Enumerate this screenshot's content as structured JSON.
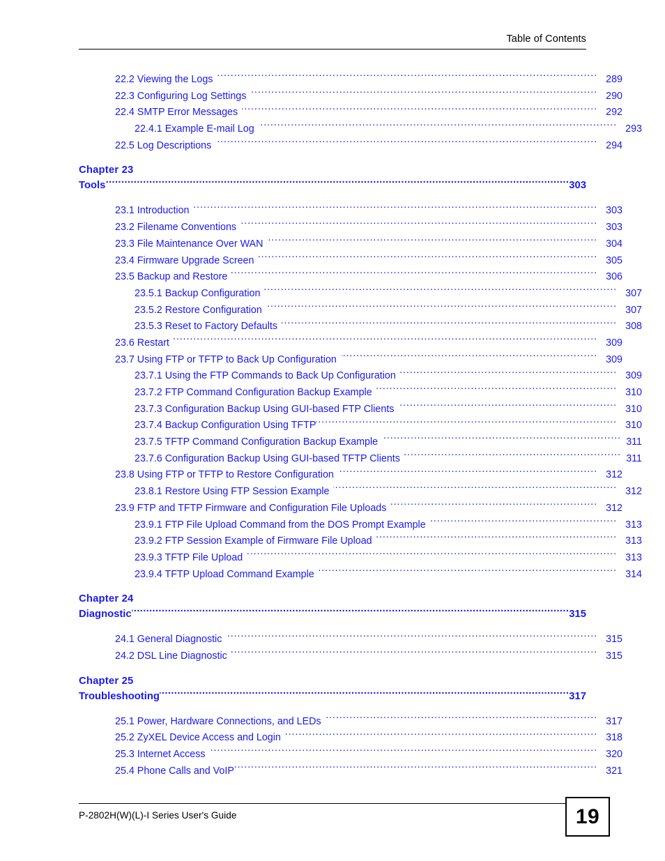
{
  "header": {
    "title": "Table of Contents"
  },
  "footer": {
    "guide_title": "P-2802H(W)(L)-I Series User's Guide",
    "page_number": "19"
  },
  "toc": {
    "blocks": [
      {
        "type": "entries",
        "entries": [
          {
            "level": 1,
            "label": "22.2 Viewing the Logs",
            "page": "289",
            "gap_before_leader": "wide",
            "gap_after_leader": "wide"
          },
          {
            "level": 1,
            "label": "22.3 Configuring Log Settings",
            "page": "290",
            "gap_before_leader": "wide",
            "gap_after_leader": "wide"
          },
          {
            "level": 1,
            "label": "22.4 SMTP Error Messages",
            "page": "292",
            "gap_before_leader": "wide",
            "gap_after_leader": "wide"
          },
          {
            "level": 2,
            "label": "22.4.1 Example E-mail Log",
            "page": "293",
            "gap_before_leader": "wide",
            "gap_after_leader": "wide"
          },
          {
            "level": 1,
            "label": "22.5 Log Descriptions",
            "page": "294",
            "gap_before_leader": "wide",
            "gap_after_leader": "wide"
          }
        ]
      },
      {
        "type": "chapter",
        "chapter_label": "Chapter  23",
        "chapter_title": "Tools",
        "page": "303"
      },
      {
        "type": "entries",
        "entries": [
          {
            "level": 1,
            "label": "23.1 Introduction",
            "page": "303",
            "gap_before_leader": "wide",
            "gap_after_leader": "wide"
          },
          {
            "level": 1,
            "label": "23.2 Filename Conventions",
            "page": "303",
            "gap_before_leader": "wide",
            "gap_after_leader": "wide"
          },
          {
            "level": 1,
            "label": "23.3 File Maintenance Over WAN",
            "page": "304",
            "gap_before_leader": "wide",
            "gap_after_leader": "wide"
          },
          {
            "level": 1,
            "label": "23.4 Firmware Upgrade Screen",
            "page": "305",
            "gap_before_leader": "wide",
            "gap_after_leader": "wide"
          },
          {
            "level": 1,
            "label": "23.5 Backup and Restore",
            "page": "306",
            "gap_before_leader": "wide",
            "gap_after_leader": "wide"
          },
          {
            "level": 2,
            "label": "23.5.1 Backup Configuration",
            "page": "307",
            "gap_before_leader": "wide",
            "gap_after_leader": "wide"
          },
          {
            "level": 2,
            "label": "23.5.2 Restore Configuration",
            "page": "307",
            "gap_before_leader": "wide",
            "gap_after_leader": "wide"
          },
          {
            "level": 2,
            "label": "23.5.3 Reset to Factory Defaults",
            "page": "308",
            "gap_before_leader": "wide",
            "gap_after_leader": "wide"
          },
          {
            "level": 1,
            "label": "23.6 Restart",
            "page": "309",
            "gap_before_leader": "wide",
            "gap_after_leader": "wide"
          },
          {
            "level": 1,
            "label": "23.7 Using FTP or TFTP to Back Up Configuration",
            "page": "309",
            "gap_before_leader": "wide",
            "gap_after_leader": "wide"
          },
          {
            "level": 2,
            "label": "23.7.1 Using the FTP Commands to Back Up Configuration",
            "page": "309",
            "gap_before_leader": "wide",
            "gap_after_leader": "wide"
          },
          {
            "level": 2,
            "label": "23.7.2 FTP Command  Configuration Backup Example",
            "page": "310",
            "gap_before_leader": "wide",
            "gap_after_leader": "wide"
          },
          {
            "level": 2,
            "label": "23.7.3 Configuration Backup Using GUI-based FTP Clients",
            "page": "310",
            "gap_before_leader": "wide",
            "gap_after_leader": "wide"
          },
          {
            "level": 2,
            "label": "23.7.4 Backup Configuration Using TFTP",
            "page": "310",
            "gap_before_leader": "none",
            "gap_after_leader": "wide"
          },
          {
            "level": 2,
            "label": "23.7.5 TFTP Command Configuration Backup Example",
            "page": "311",
            "gap_before_leader": "wide",
            "gap_after_leader": "none"
          },
          {
            "level": 2,
            "label": "23.7.6 Configuration Backup Using GUI-based TFTP Clients",
            "page": "311",
            "gap_before_leader": "wide",
            "gap_after_leader": "none"
          },
          {
            "level": 1,
            "label": "23.8 Using FTP or TFTP to Restore Configuration",
            "page": "312",
            "gap_before_leader": "wide",
            "gap_after_leader": "wide"
          },
          {
            "level": 2,
            "label": "23.8.1 Restore Using FTP Session Example",
            "page": "312",
            "gap_before_leader": "wide",
            "gap_after_leader": "wide"
          },
          {
            "level": 1,
            "label": "23.9 FTP and TFTP Firmware and Configuration File Uploads",
            "page": "312",
            "gap_before_leader": "wide",
            "gap_after_leader": "wide"
          },
          {
            "level": 2,
            "label": "23.9.1 FTP File Upload Command from the DOS Prompt Example",
            "page": "313",
            "gap_before_leader": "wide",
            "gap_after_leader": "wide"
          },
          {
            "level": 2,
            "label": "23.9.2 FTP Session Example of Firmware File Upload",
            "page": "313",
            "gap_before_leader": "wide",
            "gap_after_leader": "wide"
          },
          {
            "level": 2,
            "label": "23.9.3 TFTP File Upload",
            "page": "313",
            "gap_before_leader": "wide",
            "gap_after_leader": "wide"
          },
          {
            "level": 2,
            "label": "23.9.4 TFTP Upload Command Example",
            "page": "314",
            "gap_before_leader": "wide",
            "gap_after_leader": "wide"
          }
        ]
      },
      {
        "type": "chapter",
        "chapter_label": "Chapter  24",
        "chapter_title": "Diagnostic",
        "page": "315"
      },
      {
        "type": "entries",
        "entries": [
          {
            "level": 1,
            "label": "24.1 General Diagnostic",
            "page": "315",
            "gap_before_leader": "wide",
            "gap_after_leader": "wide"
          },
          {
            "level": 1,
            "label": "24.2 DSL Line Diagnostic",
            "page": "315",
            "gap_before_leader": "wide",
            "gap_after_leader": "wide"
          }
        ]
      },
      {
        "type": "chapter",
        "chapter_label": "Chapter  25",
        "chapter_title": "Troubleshooting",
        "page": "317"
      },
      {
        "type": "entries",
        "entries": [
          {
            "level": 1,
            "label": "25.1 Power, Hardware Connections, and LEDs",
            "page": "317",
            "gap_before_leader": "wide",
            "gap_after_leader": "wide"
          },
          {
            "level": 1,
            "label": "25.2 ZyXEL Device Access and Login",
            "page": "318",
            "gap_before_leader": "wide",
            "gap_after_leader": "wide"
          },
          {
            "level": 1,
            "label": "25.3 Internet Access",
            "page": "320",
            "gap_before_leader": "wide",
            "gap_after_leader": "wide"
          },
          {
            "level": 1,
            "label": "25.4 Phone Calls and VoIP",
            "page": "321",
            "gap_before_leader": "none",
            "gap_after_leader": "wide"
          }
        ]
      }
    ]
  },
  "colors": {
    "link_blue": "#1a1aee",
    "text_black": "#000000",
    "page_background": "#ffffff"
  }
}
